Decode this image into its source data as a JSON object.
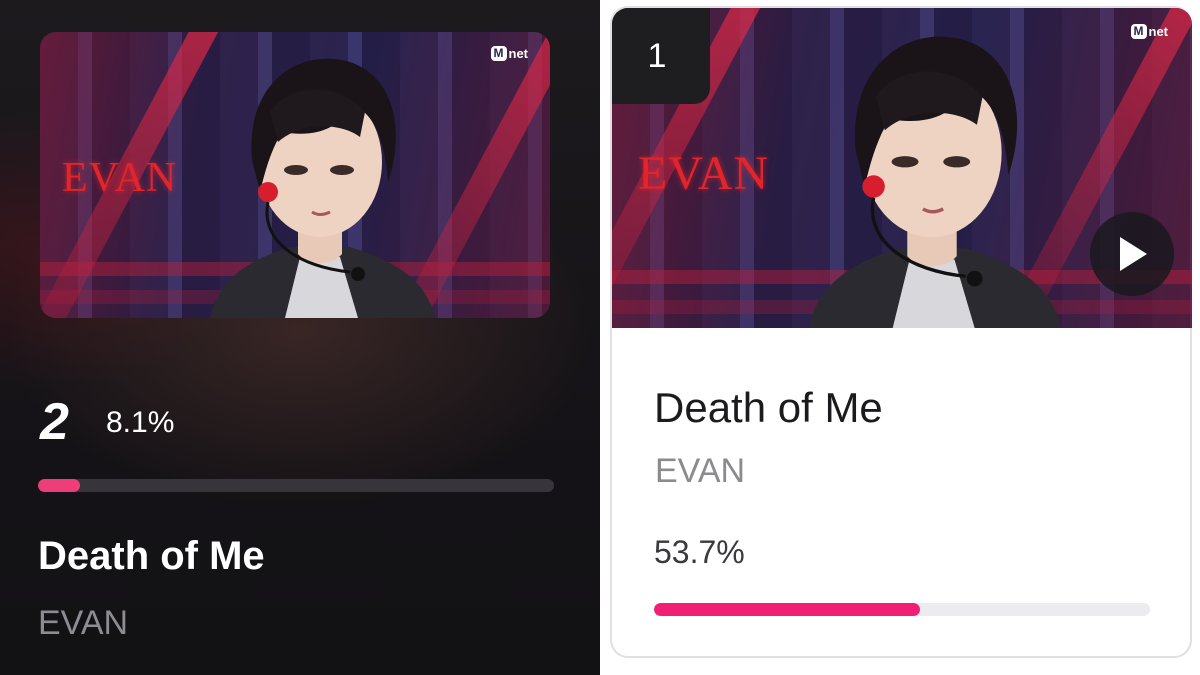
{
  "left_card": {
    "thumbnail": {
      "overlay_text": "EVAN",
      "channel_logo_m": "M",
      "channel_logo_rest": "net"
    },
    "rank": "2",
    "percent_label": "8.1%",
    "progress_fraction": 0.081,
    "title": "Death of Me",
    "artist": "EVAN",
    "accent_color": "#ee3e7a"
  },
  "right_card": {
    "rank": "1",
    "thumbnail": {
      "overlay_text": "EVAN",
      "channel_logo_m": "M",
      "channel_logo_rest": "net",
      "play_icon": "play-icon"
    },
    "title": "Death of Me",
    "artist": "EVAN",
    "percent_label": "53.7%",
    "progress_fraction": 0.537,
    "accent_color": "#f21e76"
  }
}
